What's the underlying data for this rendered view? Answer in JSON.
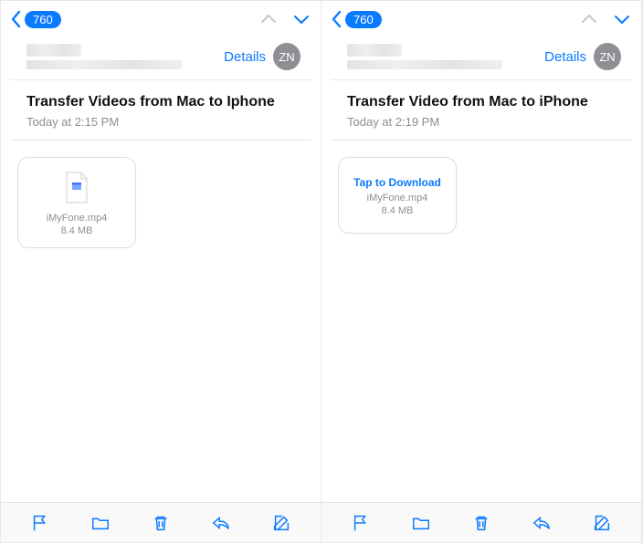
{
  "colors": {
    "accent": "#0a7aff",
    "muted": "#8e8e93"
  },
  "left": {
    "nav": {
      "back_badge": "760"
    },
    "header": {
      "details_label": "Details",
      "avatar_initials": "ZN"
    },
    "subject": "Transfer Videos from Mac to Iphone",
    "timestamp": "Today at 2:15 PM",
    "attachment": {
      "tap_label": "",
      "filename": "iMyFone.mp4",
      "filesize": "8.4 MB",
      "show_icon": true
    }
  },
  "right": {
    "nav": {
      "back_badge": "760"
    },
    "header": {
      "details_label": "Details",
      "avatar_initials": "ZN"
    },
    "subject": "Transfer Video from Mac to iPhone",
    "timestamp": "Today at 2:19 PM",
    "attachment": {
      "tap_label": "Tap to Download",
      "filename": "iMyFone.mp4",
      "filesize": "8.4 MB",
      "show_icon": false
    }
  },
  "toolbar_icons": [
    "flag-icon",
    "folder-icon",
    "trash-icon",
    "reply-icon",
    "compose-icon"
  ]
}
